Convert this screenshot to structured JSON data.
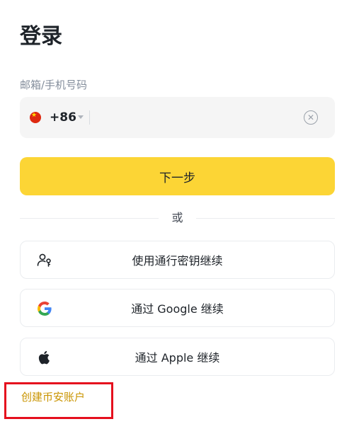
{
  "title": "登录",
  "phone": {
    "label": "邮箱/手机号码",
    "country_code": "+86",
    "value": "",
    "flag_icon": "china-flag-icon",
    "clear_icon": "clear-circle-icon"
  },
  "next_button": "下一步",
  "divider_text": "或",
  "alt_logins": [
    {
      "label": "使用通行密钥继续",
      "icon": "passkey-icon"
    },
    {
      "label": "通过 Google 继续",
      "icon": "google-icon"
    },
    {
      "label": "通过 Apple 继续",
      "icon": "apple-icon"
    }
  ],
  "create_account": "创建币安账户",
  "colors": {
    "accent": "#fcd535",
    "link": "#c99400",
    "highlight": "#e5101e"
  }
}
